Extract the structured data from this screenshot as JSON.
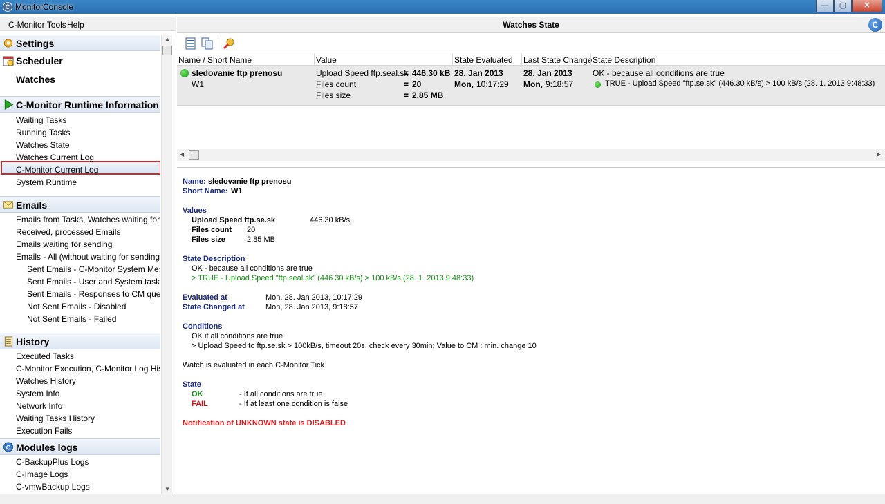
{
  "window": {
    "title": "MonitorConsole",
    "buttons": {
      "minimize": "—",
      "maximize": "▢",
      "close": "✕"
    }
  },
  "menu": {
    "items": [
      "C-Monitor Tools",
      "Help"
    ]
  },
  "sidebar": {
    "groups": {
      "settings": "Settings",
      "scheduler": "Scheduler",
      "watches": "Watches",
      "runtime": "C-Monitor Runtime Information",
      "emails": "Emails",
      "history": "History",
      "modules": "Modules logs"
    },
    "runtime_items": [
      "Waiting Tasks",
      "Running Tasks",
      "Watches State",
      "Watches Current Log",
      "C-Monitor Current Log",
      "System Runtime"
    ],
    "email_items": [
      "Emails from Tasks, Watches waiting for sending",
      "Received, processed Emails",
      "Emails waiting for sending",
      "Emails - All (without waiting for sending)"
    ],
    "email_subitems": [
      "Sent Emails - C-Monitor System Messages",
      "Sent Emails - User and System tasks Results",
      "Sent Emails - Responses to CM queries",
      "Not Sent Emails - Disabled",
      "Not Sent Emails - Failed"
    ],
    "history_items": [
      "Executed Tasks",
      "C-Monitor Execution, C-Monitor Log History",
      "Watches History",
      "System Info",
      "Network Info",
      "Waiting Tasks History",
      "Execution Fails"
    ],
    "module_items": [
      "C-BackupPlus Logs",
      "C-Image Logs",
      "C-vmwBackup Logs"
    ]
  },
  "main": {
    "title": "Watches State",
    "columns": [
      "Name / Short Name",
      "Value",
      "State Evaluated",
      "Last State Change",
      "State Description"
    ],
    "row": {
      "name": "sledovanie ftp prenosu",
      "short_name": "W1",
      "values": [
        {
          "label": "Upload Speed ftp.seal.sk",
          "eq": "=",
          "value": "446.30 kB"
        },
        {
          "label": "Files count",
          "eq": "=",
          "value": "20"
        },
        {
          "label": "Files size",
          "eq": "=",
          "value": "2.85 MB"
        }
      ],
      "evaluated_date": "28. Jan 2013",
      "evaluated_day": "Mon,",
      "evaluated_time": "10:17:29",
      "changed_date": "28. Jan 2013",
      "changed_day": "Mon,",
      "changed_time": "9:18:57",
      "desc1": "OK - because all conditions are true",
      "desc2": "TRUE - Upload Speed \"ftp.se.sk\" (446.30 kB/s) > 100 kB/s (28. 1. 2013 9:48:33)"
    }
  },
  "detail": {
    "name_label": "Name:",
    "name_value": "sledovanie ftp prenosu",
    "short_label": "Short Name:",
    "short_value": "W1",
    "values_heading": "Values",
    "values": [
      {
        "label": "Upload Speed ftp.se.sk",
        "value": "446.30 kB/s"
      },
      {
        "label": "Files count",
        "value": "20"
      },
      {
        "label": "Files size",
        "value": "2.85 MB"
      }
    ],
    "state_desc_heading": "State Description",
    "state_desc1": "OK - because all conditions are true",
    "state_desc2": "> TRUE - Upload Speed \"ftp.seal.sk\" (446.30 kB/s) > 100 kB/s (28. 1. 2013 9:48:33)",
    "evaluated_label": "Evaluated at",
    "evaluated_value": "Mon, 28. Jan 2013, 10:17:29",
    "changed_label": "State Changed at",
    "changed_value": "Mon, 28. Jan 2013, 9:18:57",
    "conditions_heading": "Conditions",
    "cond1": "OK if all conditions are true",
    "cond2": "> Upload Speed to ftp.se.sk > 100kB/s, timeout 20s, check every 30min; Value to CM : min. change 10",
    "tick_note": "Watch is evaluated in each C-Monitor Tick",
    "state_heading": "State",
    "ok_label": "OK",
    "ok_desc": "- If all conditions are true",
    "fail_label": "FAIL",
    "fail_desc": "- If at least one condition is false",
    "notification": "Notification of UNKNOWN state is DISABLED"
  }
}
